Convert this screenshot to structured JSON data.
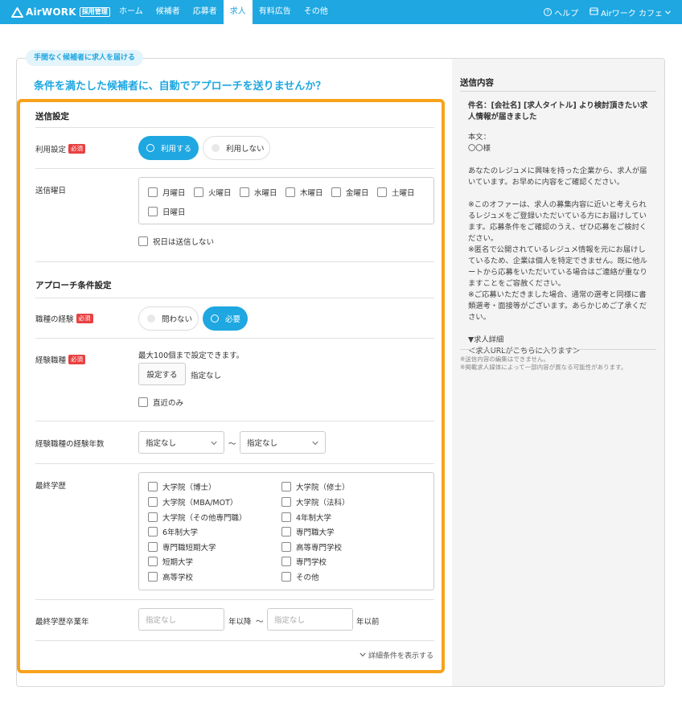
{
  "nav": {
    "logo_text": "AirWORK",
    "logo_badge": "採用管理",
    "items": [
      "ホーム",
      "候補者",
      "応募者",
      "求人",
      "有料広告",
      "その他"
    ],
    "active_index": 3,
    "help": "ヘルプ",
    "store": "Airワーク カフェ"
  },
  "tagline": "手間なく候補者に求人を届ける",
  "headline": "条件を満たした候補者に、自動でアプローチを送りませんか？",
  "send_settings": {
    "title": "送信設定",
    "use_label": "利用設定",
    "required": "必須",
    "use_on": "利用する",
    "use_off": "利用しない",
    "days_label": "送信曜日",
    "days": [
      "月曜日",
      "火曜日",
      "水曜日",
      "木曜日",
      "金曜日",
      "土曜日",
      "日曜日"
    ],
    "holiday": "祝日は送信しない"
  },
  "approach": {
    "title": "アプローチ条件設定",
    "exp_label": "職種の経験",
    "required": "必須",
    "exp_any": "問わない",
    "exp_need": "必要",
    "jobs_label": "経験職種",
    "jobs_hint": "最大100個まで設定できます。",
    "jobs_button": "設定する",
    "jobs_value": "指定なし",
    "recent_only": "直近のみ",
    "years_label": "経験職種の経験年数",
    "years_from": "指定なし",
    "years_sep": "〜",
    "years_to": "指定なし",
    "edu_label": "最終学歴",
    "edu_left": [
      "大学院（博士）",
      "大学院（MBA/MOT）",
      "大学院（その他専門職）",
      "6年制大学",
      "専門職短期大学",
      "短期大学",
      "高等学校"
    ],
    "edu_right": [
      "大学院（修士）",
      "大学院（法科）",
      "4年制大学",
      "専門職大学",
      "高等専門学校",
      "専門学校",
      "その他"
    ],
    "grad_label": "最終学歴卒業年",
    "grad_from_placeholder": "指定なし",
    "grad_from_suffix": "年以降",
    "grad_sep": "〜",
    "grad_to_placeholder": "指定なし",
    "grad_to_suffix": "年以前",
    "more": "詳細条件を表示する"
  },
  "preview": {
    "title": "送信内容",
    "subject": "件名：[会社名] [求人タイトル] より検討頂きたい求人情報が届きました",
    "body_label": "本文：",
    "salutation": "〇〇様",
    "para1": "あなたのレジュメに興味を持った企業から、求人が届いています。お早めに内容をご確認ください。",
    "para2": "※このオファーは、求人の募集内容に近いと考えられるレジュメをご登録いただいている方にお届けしています。応募条件をご確認のうえ、ぜひ応募をご検討ください。",
    "para3": "※匿名で公開されているレジュメ情報を元にお届けしているため、企業は個人を特定できません。既に他ルートから応募をいただいている場合はご連絡が重なりますことをご容赦ください。",
    "para4": "※ご応募いただきました場合、通常の選考と同様に書類選考・面接等がございます。あらかじめご了承ください。",
    "detail_title": "▼求人詳細",
    "detail_url": "＜求人URLがこちらに入ります＞",
    "note1": "※送信内容の編集はできません。",
    "note2": "※掲載求人媒体によって一部内容が異なる可能性があります。"
  },
  "colors": {
    "brand": "#1ea7e1",
    "highlight": "#f7a21b",
    "required": "#e94040"
  }
}
